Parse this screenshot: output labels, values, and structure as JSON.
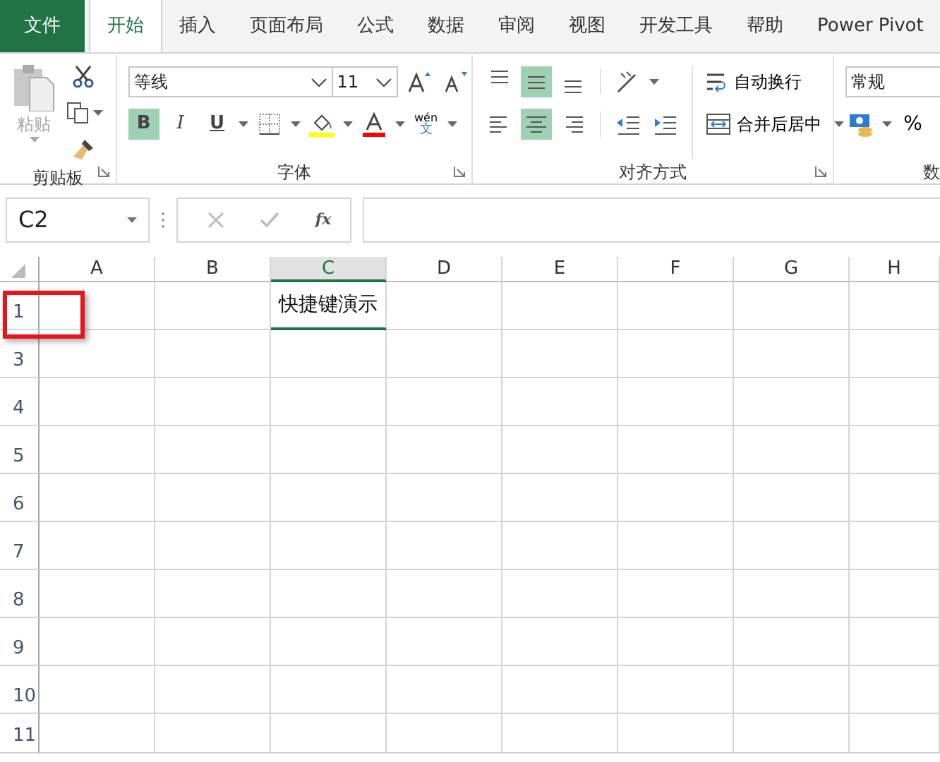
{
  "tabs": [
    {
      "label": "文件",
      "kind": "file",
      "selected": false
    },
    {
      "label": "开始",
      "kind": "tab",
      "selected": true
    },
    {
      "label": "插入",
      "kind": "tab",
      "selected": false
    },
    {
      "label": "页面布局",
      "kind": "tab",
      "selected": false
    },
    {
      "label": "公式",
      "kind": "tab",
      "selected": false
    },
    {
      "label": "数据",
      "kind": "tab",
      "selected": false
    },
    {
      "label": "审阅",
      "kind": "tab",
      "selected": false
    },
    {
      "label": "视图",
      "kind": "tab",
      "selected": false
    },
    {
      "label": "开发工具",
      "kind": "tab",
      "selected": false
    },
    {
      "label": "帮助",
      "kind": "tab",
      "selected": false
    },
    {
      "label": "Power Pivot",
      "kind": "tab",
      "selected": false
    }
  ],
  "ribbon": {
    "clipboard": {
      "label": "剪贴板",
      "paste": "粘贴"
    },
    "font": {
      "label": "字体",
      "font_name": "等线",
      "font_size": "11",
      "styles": [
        {
          "label": "B",
          "kind": "bold",
          "selected": true
        },
        {
          "label": "I",
          "kind": "italic",
          "selected": false
        },
        {
          "label": "U",
          "kind": "underline",
          "selected": false
        }
      ],
      "phonetic_top": "wén",
      "phonetic_bottom": "文"
    },
    "alignment": {
      "label": "对齐方式",
      "vertical": [
        {
          "kind": "top",
          "selected": false
        },
        {
          "kind": "middle",
          "selected": true
        },
        {
          "kind": "bottom",
          "selected": false
        }
      ],
      "horizontal": [
        {
          "kind": "left",
          "selected": false
        },
        {
          "kind": "center",
          "selected": true
        },
        {
          "kind": "right",
          "selected": false
        }
      ],
      "wrap_text": "自动换行",
      "merge_center": "合并后居中"
    },
    "number": {
      "label": "数",
      "format": "常规",
      "percent": "%"
    }
  },
  "formula_bar": {
    "name_box": "C2",
    "fx": "fx"
  },
  "sheet": {
    "columns": [
      {
        "label": "A",
        "selected": false
      },
      {
        "label": "B",
        "selected": false
      },
      {
        "label": "C",
        "selected": true
      },
      {
        "label": "D",
        "selected": false
      },
      {
        "label": "E",
        "selected": false
      },
      {
        "label": "F",
        "selected": false
      },
      {
        "label": "G",
        "selected": false
      },
      {
        "label": "H",
        "selected": false
      }
    ],
    "rows": [
      {
        "label": "1",
        "active_text": "快捷键演示",
        "marked": true
      },
      {
        "label": "3",
        "marked": false
      },
      {
        "label": "4",
        "marked": false
      },
      {
        "label": "5",
        "marked": false
      },
      {
        "label": "6",
        "marked": false
      },
      {
        "label": "7",
        "marked": false
      },
      {
        "label": "8",
        "marked": false
      },
      {
        "label": "9",
        "marked": false
      },
      {
        "label": "10",
        "marked": false
      },
      {
        "label": "11",
        "marked": false
      }
    ]
  }
}
